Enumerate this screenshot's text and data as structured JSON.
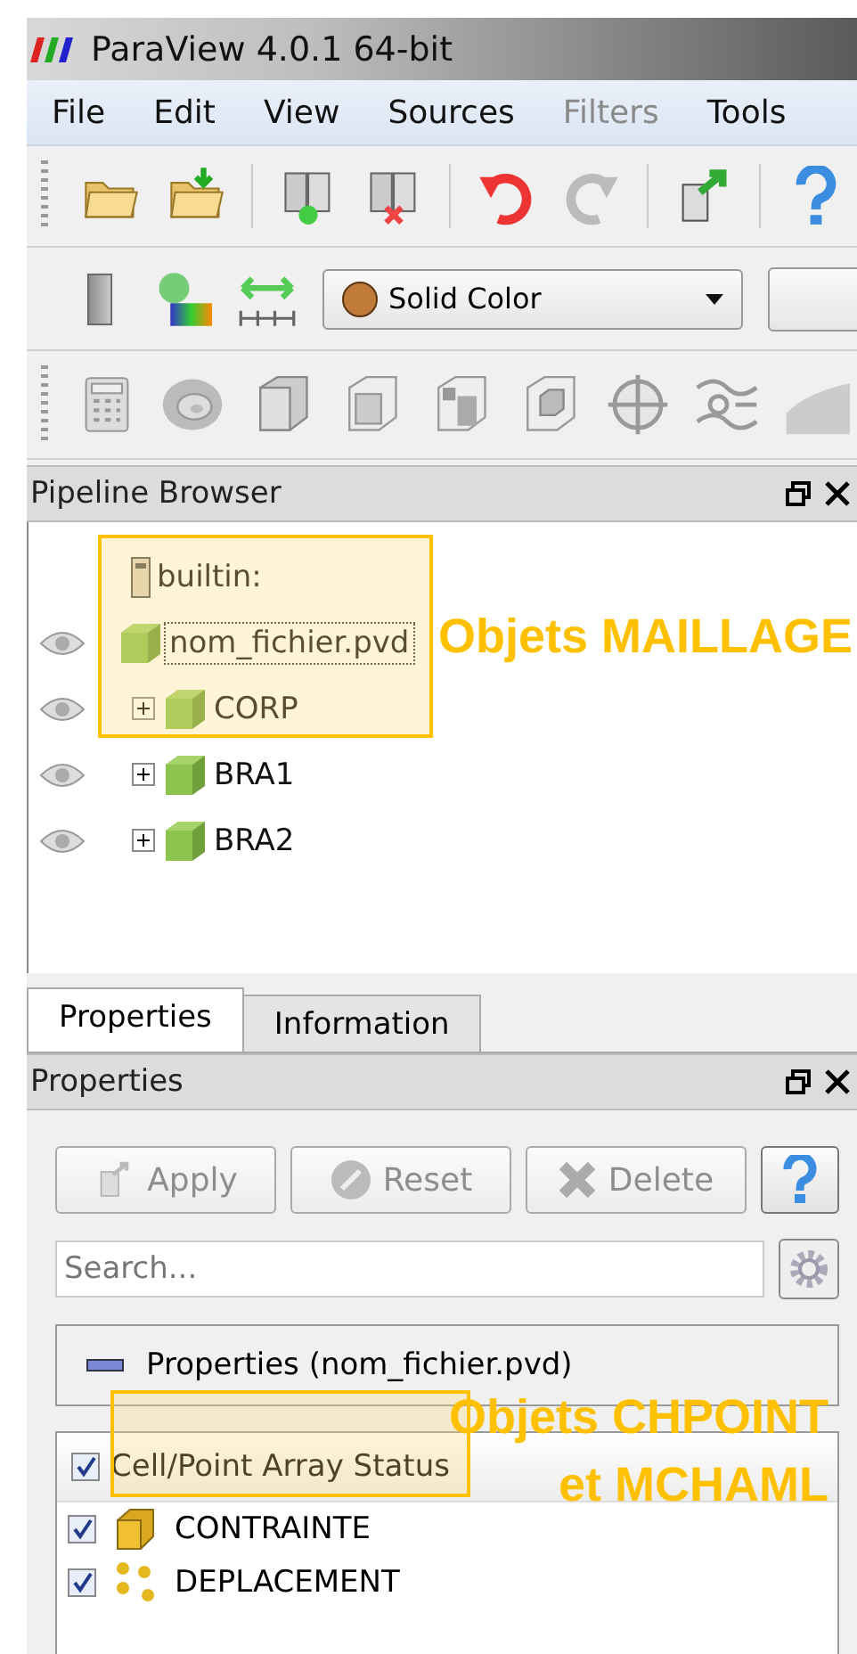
{
  "window": {
    "title": "ParaView 4.0.1 64-bit"
  },
  "menu": [
    {
      "label": "File",
      "disabled": false
    },
    {
      "label": "Edit",
      "disabled": false
    },
    {
      "label": "View",
      "disabled": false
    },
    {
      "label": "Sources",
      "disabled": false
    },
    {
      "label": "Filters",
      "disabled": true
    },
    {
      "label": "Tools",
      "disabled": false
    }
  ],
  "color_toolbar": {
    "dropdown_value": "Solid Color"
  },
  "pipeline_browser": {
    "title": "Pipeline Browser",
    "tree": [
      {
        "label": "builtin:",
        "kind": "server",
        "selected": false,
        "children": [
          {
            "label": "nom_fichier.pvd",
            "kind": "source",
            "selected": true,
            "children": [
              {
                "label": "CORP",
                "kind": "block",
                "selected": false,
                "expanded": false
              },
              {
                "label": "BRA1",
                "kind": "block",
                "selected": false,
                "expanded": false
              },
              {
                "label": "BRA2",
                "kind": "block",
                "selected": false,
                "expanded": false
              }
            ]
          }
        ]
      }
    ]
  },
  "tabs": [
    {
      "label": "Properties",
      "selected": true
    },
    {
      "label": "Information",
      "selected": false
    }
  ],
  "properties": {
    "title": "Properties",
    "buttons": [
      {
        "label": "Apply",
        "kind": "apply",
        "disabled": true
      },
      {
        "label": "Reset",
        "kind": "reset",
        "disabled": true
      },
      {
        "label": "Delete",
        "kind": "delete",
        "disabled": true
      }
    ],
    "search": {
      "placeholder": "Search..."
    },
    "group_title": "Properties (nom_fichier.pvd)",
    "arrays": {
      "header": "Cell/Point Array Status",
      "checked": true,
      "items": [
        {
          "label": "CONTRAINTE",
          "kind": "cell",
          "checked": true
        },
        {
          "label": "DEPLACEMENT",
          "kind": "point",
          "checked": true
        }
      ]
    }
  },
  "annotations": [
    {
      "lines": [
        "Objets MAILLAGE"
      ]
    },
    {
      "lines": [
        "Objets CHPOINT",
        "et MCHAML"
      ]
    }
  ]
}
